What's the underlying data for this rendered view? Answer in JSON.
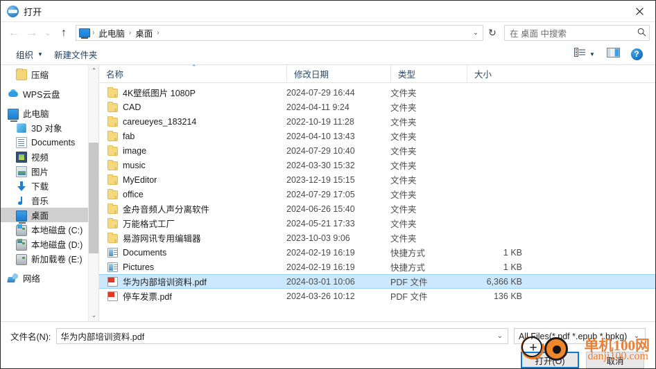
{
  "window": {
    "title": "打开",
    "app_icon": "open-dialog-icon",
    "close_label": "✕"
  },
  "address_bar": {
    "back_icon": "arrow-left-icon",
    "forward_icon": "arrow-right-icon",
    "recent_icon": "chevron-down-icon",
    "up_icon": "arrow-up-icon",
    "breadcrumb_icon": "this-pc-icon",
    "crumbs": [
      "此电脑",
      "桌面"
    ],
    "separator": "›",
    "dropdown_icon": "chevron-down-icon",
    "refresh_icon": "↻"
  },
  "search": {
    "placeholder": "在 桌面 中搜索",
    "icon": "search-icon"
  },
  "command_bar": {
    "organize_label": "组织",
    "organize_caret": "▼",
    "new_folder_label": "新建文件夹",
    "view_icon": "list-view-icon",
    "view_caret": "▼",
    "preview_icon": "preview-pane-icon",
    "help_icon": "?"
  },
  "sidebar": {
    "items": [
      {
        "label": "压缩",
        "icon": "folder-icon",
        "indent": 1,
        "selected": false
      },
      {
        "label": "WPS云盘",
        "icon": "cloud-icon",
        "indent": 0,
        "selected": false,
        "gap_before": true
      },
      {
        "label": "此电脑",
        "icon": "computer-icon",
        "indent": 0,
        "selected": false,
        "gap_before": true
      },
      {
        "label": "3D 对象",
        "icon": "3d-objects-icon",
        "indent": 1,
        "selected": false
      },
      {
        "label": "Documents",
        "icon": "documents-icon",
        "indent": 1,
        "selected": false
      },
      {
        "label": "视频",
        "icon": "videos-icon",
        "indent": 1,
        "selected": false
      },
      {
        "label": "图片",
        "icon": "pictures-icon",
        "indent": 1,
        "selected": false
      },
      {
        "label": "下载",
        "icon": "downloads-icon",
        "indent": 1,
        "selected": false
      },
      {
        "label": "音乐",
        "icon": "music-icon",
        "indent": 1,
        "selected": false
      },
      {
        "label": "桌面",
        "icon": "desktop-icon",
        "indent": 1,
        "selected": true
      },
      {
        "label": "本地磁盘 (C:)",
        "icon": "drive-c-icon",
        "indent": 1,
        "selected": false
      },
      {
        "label": "本地磁盘 (D:)",
        "icon": "drive-d-icon",
        "indent": 1,
        "selected": false
      },
      {
        "label": "新加载卷 (E:)",
        "icon": "drive-e-icon",
        "indent": 1,
        "selected": false
      },
      {
        "label": "网络",
        "icon": "network-icon",
        "indent": 0,
        "selected": false,
        "gap_before": true
      }
    ],
    "scrollbar": {
      "up_arrow": "⌃",
      "down_arrow": "⌄"
    }
  },
  "file_list": {
    "columns": [
      {
        "label": "名称",
        "key": "name"
      },
      {
        "label": "修改日期",
        "key": "date"
      },
      {
        "label": "类型",
        "key": "type"
      },
      {
        "label": "大小",
        "key": "size"
      }
    ],
    "sort_indicator": "⌃",
    "sort_column": "名称",
    "rows": [
      {
        "name": "4K壁纸图片 1080P",
        "date": "2024-07-29 16:44",
        "type": "文件夹",
        "size": "",
        "icon": "folder-icon",
        "selected": false
      },
      {
        "name": "CAD",
        "date": "2024-04-11 9:24",
        "type": "文件夹",
        "size": "",
        "icon": "folder-icon",
        "selected": false
      },
      {
        "name": "careueyes_183214",
        "date": "2022-10-19 11:28",
        "type": "文件夹",
        "size": "",
        "icon": "folder-icon",
        "selected": false
      },
      {
        "name": "fab",
        "date": "2024-04-10 13:43",
        "type": "文件夹",
        "size": "",
        "icon": "folder-icon",
        "selected": false
      },
      {
        "name": "image",
        "date": "2024-07-29 10:40",
        "type": "文件夹",
        "size": "",
        "icon": "folder-icon",
        "selected": false
      },
      {
        "name": "music",
        "date": "2024-03-30 15:32",
        "type": "文件夹",
        "size": "",
        "icon": "folder-icon",
        "selected": false
      },
      {
        "name": "MyEditor",
        "date": "2023-12-19 15:15",
        "type": "文件夹",
        "size": "",
        "icon": "folder-icon",
        "selected": false
      },
      {
        "name": "office",
        "date": "2024-07-29 17:05",
        "type": "文件夹",
        "size": "",
        "icon": "folder-icon",
        "selected": false
      },
      {
        "name": "金舟音频人声分离软件",
        "date": "2024-06-26 15:40",
        "type": "文件夹",
        "size": "",
        "icon": "folder-icon",
        "selected": false
      },
      {
        "name": "万能格式工厂",
        "date": "2024-05-21 17:33",
        "type": "文件夹",
        "size": "",
        "icon": "folder-icon",
        "selected": false
      },
      {
        "name": "易游网讯专用编辑器",
        "date": "2023-10-03 9:06",
        "type": "文件夹",
        "size": "",
        "icon": "folder-icon",
        "selected": false
      },
      {
        "name": "Documents",
        "date": "2024-02-19 16:19",
        "type": "快捷方式",
        "size": "1 KB",
        "icon": "shortcut-icon",
        "selected": false
      },
      {
        "name": "Pictures",
        "date": "2024-02-19 16:19",
        "type": "快捷方式",
        "size": "1 KB",
        "icon": "shortcut-icon",
        "selected": false
      },
      {
        "name": "华为内部培训资料.pdf",
        "date": "2024-03-01 10:06",
        "type": "PDF 文件",
        "size": "6,366 KB",
        "icon": "pdf-icon",
        "selected": true
      },
      {
        "name": "停车发票.pdf",
        "date": "2024-03-26 10:12",
        "type": "PDF 文件",
        "size": "136 KB",
        "icon": "pdf-icon",
        "selected": false
      }
    ]
  },
  "footer": {
    "filename_label": "文件名(N):",
    "filename_value": "华为内部培训资料.pdf",
    "filename_dropdown_icon": "chevron-down-icon",
    "filter_value": "All Files(*.pdf *.epub *.bpkg)",
    "filter_dropdown_icon": "chevron-down-icon",
    "open_button": "打开(O)",
    "cancel_button": "取消"
  },
  "watermark": {
    "line1": "单机100网",
    "line2": "danji100.com",
    "color": "#e8762a"
  },
  "colors": {
    "selection_blue": "#cce8ff",
    "selection_border": "#99d1ff",
    "sidebar_selection": "#cfcfcf",
    "focus_border": "#0a7ad6",
    "header_text": "#2b4a6b"
  }
}
